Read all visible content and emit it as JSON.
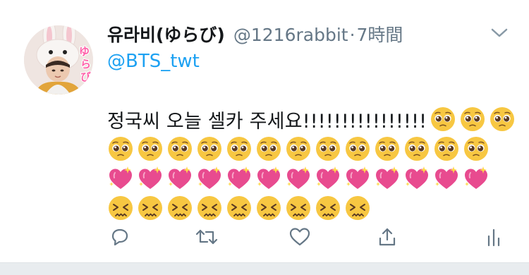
{
  "tweet": {
    "display_name": "유라비(ゆらび)",
    "handle": "@1216rabbit",
    "separator": "·",
    "time": "7時間",
    "mention": "@BTS_twt",
    "text": "정국씨 오늘 셀카 주세요!!!!!!!!!!!!!!!!",
    "avatar_label": "ゆらび"
  },
  "emoji_lines": [
    [
      "pleading-face-emoji",
      "pleading-face-emoji",
      "pleading-face-emoji"
    ],
    [
      "pleading-face-emoji",
      "pleading-face-emoji",
      "pleading-face-emoji",
      "pleading-face-emoji",
      "pleading-face-emoji",
      "pleading-face-emoji",
      "pleading-face-emoji",
      "pleading-face-emoji",
      "pleading-face-emoji",
      "pleading-face-emoji",
      "pleading-face-emoji",
      "pleading-face-emoji",
      "pleading-face-emoji"
    ],
    [
      "sparkling-heart-emoji",
      "sparkling-heart-emoji",
      "sparkling-heart-emoji",
      "sparkling-heart-emoji",
      "sparkling-heart-emoji",
      "sparkling-heart-emoji",
      "sparkling-heart-emoji",
      "sparkling-heart-emoji",
      "sparkling-heart-emoji",
      "sparkling-heart-emoji",
      "sparkling-heart-emoji",
      "sparkling-heart-emoji",
      "sparkling-heart-emoji"
    ],
    [
      "persevering-face-emoji",
      "persevering-face-emoji",
      "persevering-face-emoji",
      "persevering-face-emoji",
      "persevering-face-emoji",
      "persevering-face-emoji",
      "persevering-face-emoji",
      "persevering-face-emoji",
      "persevering-face-emoji"
    ]
  ],
  "actions": [
    "reply-icon",
    "retweet-icon",
    "like-icon",
    "share-icon",
    "analytics-icon"
  ],
  "colors": {
    "link": "#1da1f2",
    "secondary_text": "#657786",
    "icon_gray": "#657786",
    "emoji_yellow": "#f7c742",
    "heart_pink": "#e84b8f"
  }
}
